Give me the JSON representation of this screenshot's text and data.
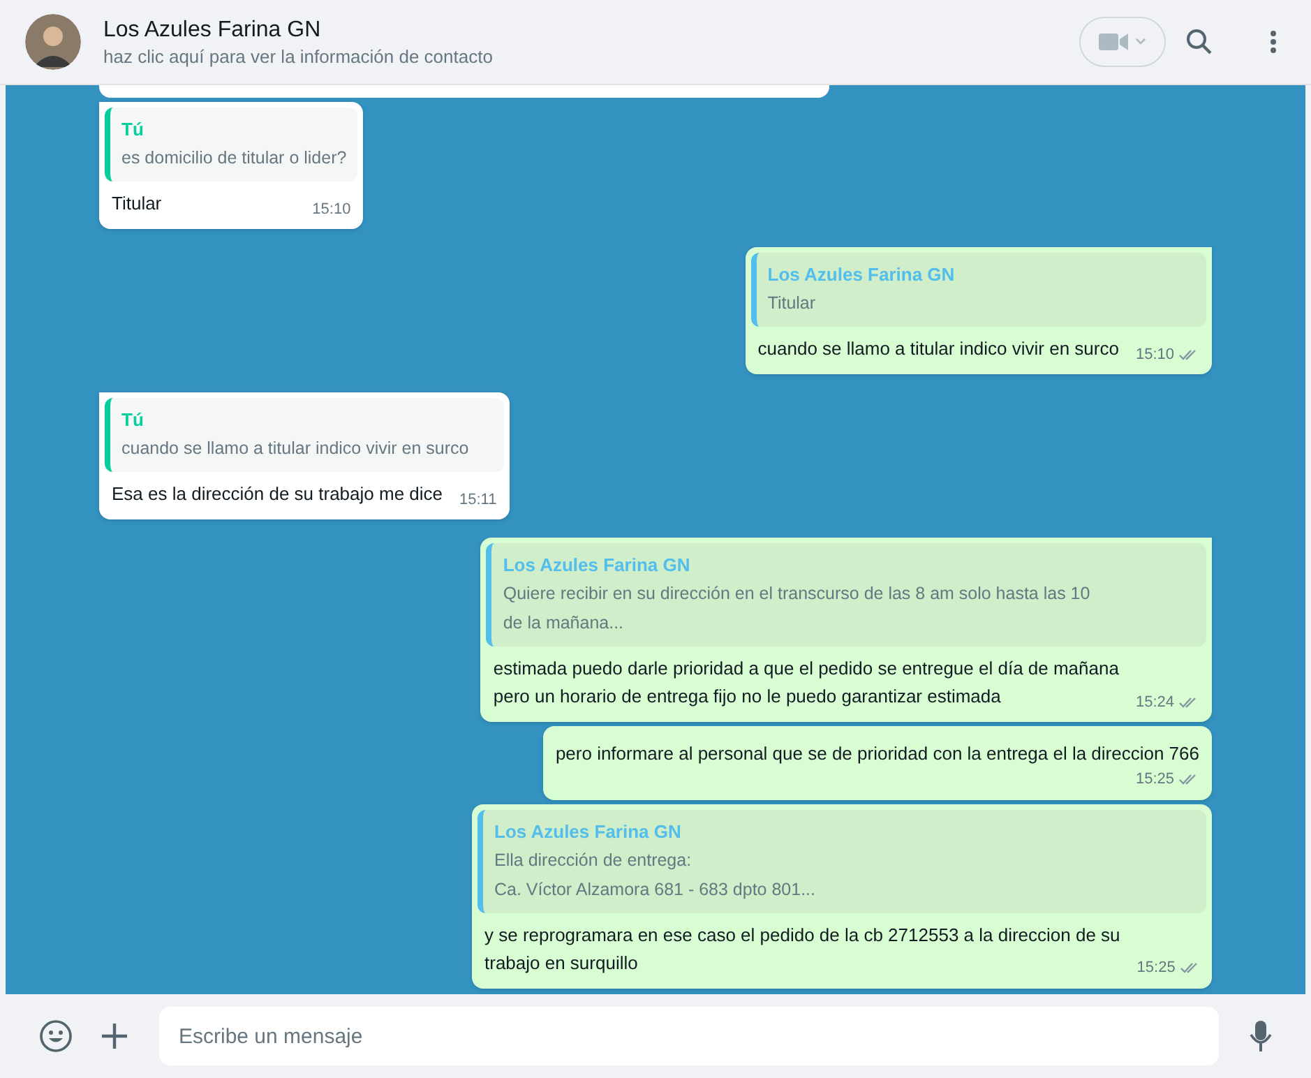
{
  "header": {
    "contact_name": "Los Azules Farina GN",
    "subtitle": "haz clic aquí para ver la información de contacto"
  },
  "messages": [
    {
      "outgoing": false,
      "quote": {
        "author": "Tú",
        "color": "#06cf9c",
        "lines": [
          "es domicilio de titular o lider?"
        ]
      },
      "lines": [
        "Titular"
      ],
      "time": "15:10"
    },
    {
      "outgoing": true,
      "quote": {
        "author": "Los Azules Farina GN",
        "color": "#53bdeb",
        "lines": [
          "Titular"
        ]
      },
      "lines": [
        "cuando se llamo a titular indico vivir en surco"
      ],
      "time": "15:10",
      "read": false
    },
    {
      "outgoing": false,
      "quote": {
        "author": "Tú",
        "color": "#06cf9c",
        "lines": [
          "cuando se llamo a titular indico vivir en surco"
        ]
      },
      "lines": [
        "Esa es la dirección de su trabajo me dice"
      ],
      "time": "15:11"
    },
    {
      "outgoing": true,
      "quote": {
        "author": "Los Azules Farina GN",
        "color": "#53bdeb",
        "lines": [
          "Quiere recibir en su dirección en el transcurso de las 8 am solo hasta las 10",
          "de la mañana..."
        ]
      },
      "lines": [
        "estimada puedo darle prioridad a que el pedido se entregue el día de mañana",
        "pero un horario de entrega fijo no le puedo garantizar estimada"
      ],
      "time": "15:24",
      "read": false
    },
    {
      "outgoing": true,
      "lines": [
        "pero informare al personal que se de prioridad con la entrega el la direccion 766"
      ],
      "time": "15:25",
      "read": false
    },
    {
      "outgoing": true,
      "quote": {
        "author": "Los Azules Farina GN",
        "color": "#53bdeb",
        "lines": [
          "Ella dirección de entrega:",
          "Ca. Víctor Alzamora 681 - 683 dpto 801..."
        ]
      },
      "lines": [
        "y se reprogramara en ese caso el pedido de la cb 2712553 a la direccion de su",
        "trabajo en surquillo"
      ],
      "time": "15:25",
      "read": false
    }
  ],
  "composer": {
    "placeholder": "Escribe un mensaje"
  }
}
